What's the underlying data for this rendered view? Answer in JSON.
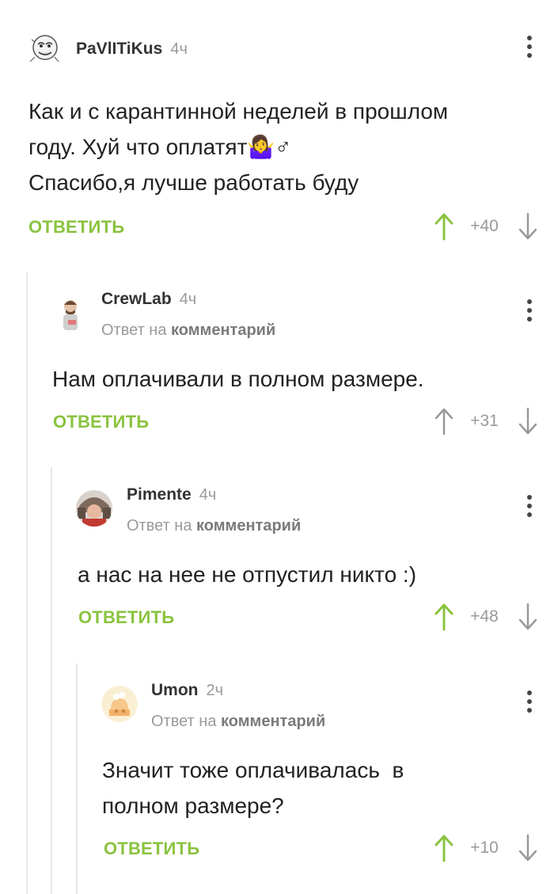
{
  "reply_label": "ОТВЕТИТЬ",
  "reply_prefix": "Ответ на",
  "reply_target": "комментарий",
  "colors": {
    "accent": "#8ac33f",
    "muted": "#9a9a9a",
    "thread": "#e6e6e6"
  },
  "comments": [
    {
      "author": "PaVlITiKus",
      "time": "4ч",
      "text_lines": [
        "Как и с карантинной неделей в прошлом",
        "году. Хуй что оплатят🤷‍♀️♂",
        "Спасибо,я лучше работать буду"
      ],
      "rating": "+40",
      "vote_up_active": true
    },
    {
      "author": "CrewLab",
      "time": "4ч",
      "text_lines": [
        "Нам оплачивали в полном размере."
      ],
      "rating": "+31",
      "vote_up_active": false
    },
    {
      "author": "Pimente",
      "time": "4ч",
      "text_lines": [
        "а нас на нее не отпустил никто :)"
      ],
      "rating": "+48",
      "vote_up_active": true
    },
    {
      "author": "Umon",
      "time": "2ч",
      "text_lines": [
        "Значит тоже оплачивалась  в",
        "полном размере?"
      ],
      "rating": "+10",
      "vote_up_active": true
    }
  ]
}
